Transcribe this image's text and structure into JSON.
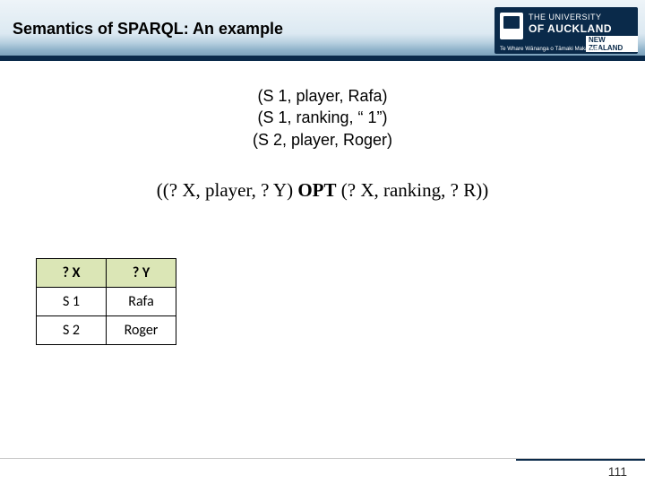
{
  "header": {
    "title": "Semantics of SPARQL: An example",
    "logo": {
      "line1": "THE UNIVERSITY",
      "line2": "OF AUCKLAND",
      "nz": "NEW ZEALAND",
      "maori": "Te Whare Wānanga o Tāmaki Makaurau"
    }
  },
  "triples": {
    "t1": "(S 1, player, Rafa)",
    "t2": "(S 1, ranking, “ 1”)",
    "t3": "(S 2, player, Roger)"
  },
  "query": {
    "left": "((? X, player, ? Y) ",
    "opt": "OPT",
    "right": " (? X, ranking, ? R))"
  },
  "table": {
    "headers": {
      "c0": "? X",
      "c1": "? Y"
    },
    "rows": [
      {
        "c0": "S 1",
        "c1": "Rafa"
      },
      {
        "c0": "S 2",
        "c1": "Roger"
      }
    ]
  },
  "page_number": "111"
}
